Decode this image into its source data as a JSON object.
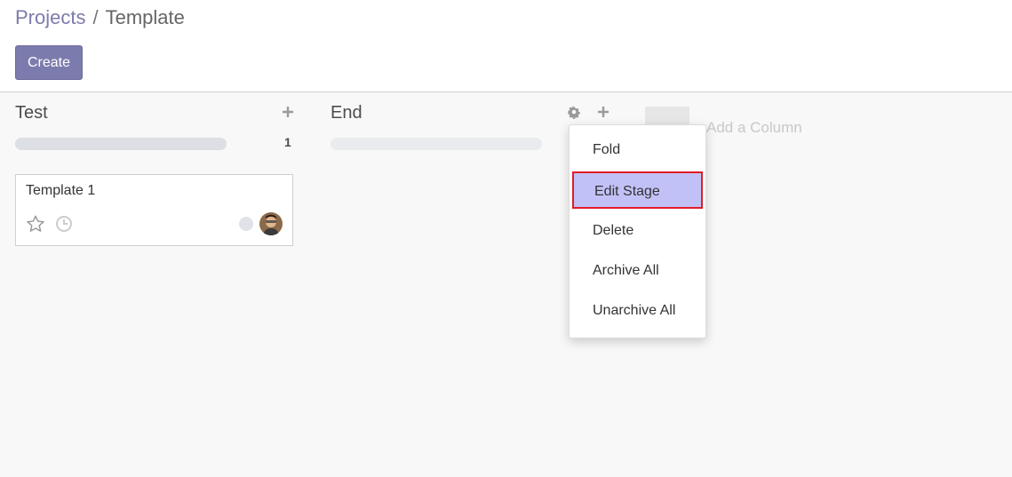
{
  "breadcrumb": {
    "parent": "Projects",
    "separator": "/",
    "current": "Template"
  },
  "toolbar": {
    "create_label": "Create"
  },
  "columns": [
    {
      "title": "Test",
      "count": "1",
      "add_icon": "plus-icon"
    },
    {
      "title": "End",
      "settings_icon": "gear-icon",
      "add_icon": "plus-icon"
    }
  ],
  "card": {
    "title": "Template 1",
    "star_icon": "star-outline-icon",
    "clock_icon": "clock-icon"
  },
  "add_column": {
    "label": "Add a Column"
  },
  "stage_menu": {
    "items": [
      "Fold",
      "Edit Stage",
      "Delete",
      "Archive All",
      "Unarchive All"
    ],
    "active": "Edit Stage"
  },
  "colors": {
    "accent": "#7c7bad",
    "highlight": "#c2c1f7",
    "highlight_border": "#e21c25"
  }
}
